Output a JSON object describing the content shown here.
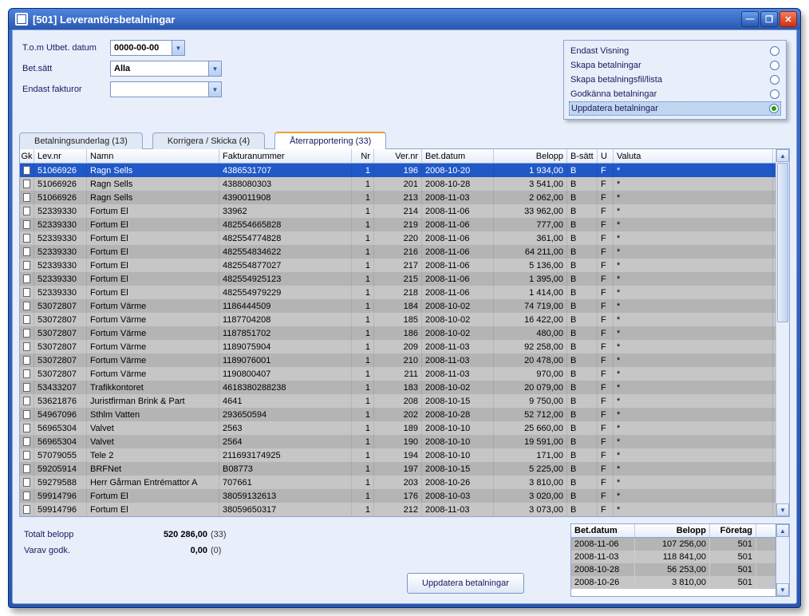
{
  "window": {
    "title": "[501]  Leverantörsbetalningar"
  },
  "filters": {
    "date_label": "T.o.m Utbet. datum",
    "date_value": "0000-00-00",
    "method_label": "Bet.sätt",
    "method_value": "Alla",
    "invoices_label": "Endast fakturor",
    "invoices_value": ""
  },
  "options": [
    {
      "label": "Endast Visning",
      "checked": false
    },
    {
      "label": "Skapa betalningar",
      "checked": false
    },
    {
      "label": "Skapa betalningsfil/lista",
      "checked": false
    },
    {
      "label": "Godkänna betalningar",
      "checked": false
    },
    {
      "label": "Uppdatera betalningar",
      "checked": true
    }
  ],
  "tabs": [
    {
      "label": "Betalningsunderlag (13)",
      "active": false
    },
    {
      "label": "Korrigera / Skicka (4)",
      "active": false
    },
    {
      "label": "Återrapportering (33)",
      "active": true
    }
  ],
  "columns": {
    "gk": "Gk",
    "lev": "Lev.nr",
    "namn": "Namn",
    "fak": "Fakturanummer",
    "nr": "Nr",
    "ver": "Ver.nr",
    "dat": "Bet.datum",
    "bel": "Belopp",
    "bsatt": "B-sätt",
    "u": "U",
    "valuta": "Valuta"
  },
  "rows": [
    {
      "lev": "51066926",
      "namn": "Ragn Sells",
      "fak": "4386531707",
      "nr": "1",
      "ver": "196",
      "dat": "2008-10-20",
      "bel": "1 934,00",
      "bs": "B",
      "u": "F",
      "val": "*",
      "sel": true
    },
    {
      "lev": "51066926",
      "namn": "Ragn Sells",
      "fak": "4388080303",
      "nr": "1",
      "ver": "201",
      "dat": "2008-10-28",
      "bel": "3 541,00",
      "bs": "B",
      "u": "F",
      "val": "*"
    },
    {
      "lev": "51066926",
      "namn": "Ragn Sells",
      "fak": "4390011908",
      "nr": "1",
      "ver": "213",
      "dat": "2008-11-03",
      "bel": "2 062,00",
      "bs": "B",
      "u": "F",
      "val": "*"
    },
    {
      "lev": "52339330",
      "namn": "Fortum El",
      "fak": "33962",
      "nr": "1",
      "ver": "214",
      "dat": "2008-11-06",
      "bel": "33 962,00",
      "bs": "B",
      "u": "F",
      "val": "*"
    },
    {
      "lev": "52339330",
      "namn": "Fortum El",
      "fak": "482554665828",
      "nr": "1",
      "ver": "219",
      "dat": "2008-11-06",
      "bel": "777,00",
      "bs": "B",
      "u": "F",
      "val": "*"
    },
    {
      "lev": "52339330",
      "namn": "Fortum El",
      "fak": "482554774828",
      "nr": "1",
      "ver": "220",
      "dat": "2008-11-06",
      "bel": "361,00",
      "bs": "B",
      "u": "F",
      "val": "*"
    },
    {
      "lev": "52339330",
      "namn": "Fortum El",
      "fak": "482554834622",
      "nr": "1",
      "ver": "216",
      "dat": "2008-11-06",
      "bel": "64 211,00",
      "bs": "B",
      "u": "F",
      "val": "*"
    },
    {
      "lev": "52339330",
      "namn": "Fortum El",
      "fak": "482554877027",
      "nr": "1",
      "ver": "217",
      "dat": "2008-11-06",
      "bel": "5 136,00",
      "bs": "B",
      "u": "F",
      "val": "*"
    },
    {
      "lev": "52339330",
      "namn": "Fortum El",
      "fak": "482554925123",
      "nr": "1",
      "ver": "215",
      "dat": "2008-11-06",
      "bel": "1 395,00",
      "bs": "B",
      "u": "F",
      "val": "*"
    },
    {
      "lev": "52339330",
      "namn": "Fortum El",
      "fak": "482554979229",
      "nr": "1",
      "ver": "218",
      "dat": "2008-11-06",
      "bel": "1 414,00",
      "bs": "B",
      "u": "F",
      "val": "*"
    },
    {
      "lev": "53072807",
      "namn": "Fortum Värme",
      "fak": "1186444509",
      "nr": "1",
      "ver": "184",
      "dat": "2008-10-02",
      "bel": "74 719,00",
      "bs": "B",
      "u": "F",
      "val": "*"
    },
    {
      "lev": "53072807",
      "namn": "Fortum Värme",
      "fak": "1187704208",
      "nr": "1",
      "ver": "185",
      "dat": "2008-10-02",
      "bel": "16 422,00",
      "bs": "B",
      "u": "F",
      "val": "*"
    },
    {
      "lev": "53072807",
      "namn": "Fortum Värme",
      "fak": "1187851702",
      "nr": "1",
      "ver": "186",
      "dat": "2008-10-02",
      "bel": "480,00",
      "bs": "B",
      "u": "F",
      "val": "*"
    },
    {
      "lev": "53072807",
      "namn": "Fortum Värme",
      "fak": "1189075904",
      "nr": "1",
      "ver": "209",
      "dat": "2008-11-03",
      "bel": "92 258,00",
      "bs": "B",
      "u": "F",
      "val": "*"
    },
    {
      "lev": "53072807",
      "namn": "Fortum Värme",
      "fak": "1189076001",
      "nr": "1",
      "ver": "210",
      "dat": "2008-11-03",
      "bel": "20 478,00",
      "bs": "B",
      "u": "F",
      "val": "*"
    },
    {
      "lev": "53072807",
      "namn": "Fortum Värme",
      "fak": "1190800407",
      "nr": "1",
      "ver": "211",
      "dat": "2008-11-03",
      "bel": "970,00",
      "bs": "B",
      "u": "F",
      "val": "*"
    },
    {
      "lev": "53433207",
      "namn": "Trafikkontoret",
      "fak": "4618380288238",
      "nr": "1",
      "ver": "183",
      "dat": "2008-10-02",
      "bel": "20 079,00",
      "bs": "B",
      "u": "F",
      "val": "*"
    },
    {
      "lev": "53621876",
      "namn": "Juristfirman Brink & Part",
      "fak": "4641",
      "nr": "1",
      "ver": "208",
      "dat": "2008-10-15",
      "bel": "9 750,00",
      "bs": "B",
      "u": "F",
      "val": "*"
    },
    {
      "lev": "54967096",
      "namn": "Sthlm Vatten",
      "fak": "293650594",
      "nr": "1",
      "ver": "202",
      "dat": "2008-10-28",
      "bel": "52 712,00",
      "bs": "B",
      "u": "F",
      "val": "*"
    },
    {
      "lev": "56965304",
      "namn": "Valvet",
      "fak": "2563",
      "nr": "1",
      "ver": "189",
      "dat": "2008-10-10",
      "bel": "25 660,00",
      "bs": "B",
      "u": "F",
      "val": "*"
    },
    {
      "lev": "56965304",
      "namn": "Valvet",
      "fak": "2564",
      "nr": "1",
      "ver": "190",
      "dat": "2008-10-10",
      "bel": "19 591,00",
      "bs": "B",
      "u": "F",
      "val": "*"
    },
    {
      "lev": "57079055",
      "namn": "Tele 2",
      "fak": "211693174925",
      "nr": "1",
      "ver": "194",
      "dat": "2008-10-10",
      "bel": "171,00",
      "bs": "B",
      "u": "F",
      "val": "*"
    },
    {
      "lev": "59205914",
      "namn": "BRFNet",
      "fak": "B08773",
      "nr": "1",
      "ver": "197",
      "dat": "2008-10-15",
      "bel": "5 225,00",
      "bs": "B",
      "u": "F",
      "val": "*"
    },
    {
      "lev": "59279588",
      "namn": "Herr Gårman Entrémattor A",
      "fak": "707661",
      "nr": "1",
      "ver": "203",
      "dat": "2008-10-26",
      "bel": "3 810,00",
      "bs": "B",
      "u": "F",
      "val": "*"
    },
    {
      "lev": "59914796",
      "namn": "Fortum El",
      "fak": "38059132613",
      "nr": "1",
      "ver": "176",
      "dat": "2008-10-03",
      "bel": "3 020,00",
      "bs": "B",
      "u": "F",
      "val": "*"
    },
    {
      "lev": "59914796",
      "namn": "Fortum El",
      "fak": "38059650317",
      "nr": "1",
      "ver": "212",
      "dat": "2008-11-03",
      "bel": "3 073,00",
      "bs": "B",
      "u": "F",
      "val": "*"
    }
  ],
  "totals": {
    "total_label": "Totalt belopp",
    "total_value": "520 286,00",
    "total_count": "(33)",
    "godk_label": "Varav godk.",
    "godk_value": "0,00",
    "godk_count": "(0)",
    "button": "Uppdatera betalningar"
  },
  "summary": {
    "headers": {
      "c1": "Bet.datum",
      "c2": "Belopp",
      "c3": "Företag"
    },
    "rows": [
      {
        "c1": "2008-11-06",
        "c2": "107 256,00",
        "c3": "501"
      },
      {
        "c1": "2008-11-03",
        "c2": "118 841,00",
        "c3": "501"
      },
      {
        "c1": "2008-10-28",
        "c2": "56 253,00",
        "c3": "501"
      },
      {
        "c1": "2008-10-26",
        "c2": "3 810,00",
        "c3": "501"
      }
    ]
  }
}
